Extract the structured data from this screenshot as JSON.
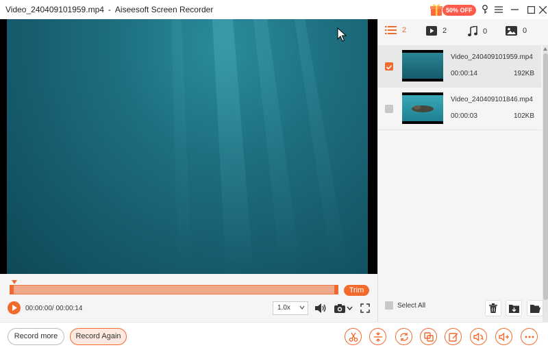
{
  "window": {
    "file_name": "Video_240409101959.mp4",
    "separator": "-",
    "app_name": "Aiseesoft Screen Recorder",
    "promo_label": "50% OFF"
  },
  "player": {
    "time": "00:00:00/ 00:00:14",
    "trim_label": "Trim",
    "speed": "1.0x",
    "progress": 0.0
  },
  "media_tabs": [
    {
      "icon": "list-icon",
      "count": "2",
      "active": true
    },
    {
      "icon": "video-play-icon",
      "count": "2",
      "active": false
    },
    {
      "icon": "music-note-icon",
      "count": "0",
      "active": false
    },
    {
      "icon": "image-icon",
      "count": "0",
      "active": false
    }
  ],
  "files": [
    {
      "name": "Video_240409101959.mp4",
      "duration": "00:00:14",
      "size": "192KB",
      "checked": true
    },
    {
      "name": "Video_240409101846.mp4",
      "duration": "00:00:03",
      "size": "102KB",
      "checked": false
    }
  ],
  "panel": {
    "select_all_label": "Select All"
  },
  "bottom": {
    "record_more_label": "Record more",
    "record_again_label": "Record Again",
    "tools": [
      "scissors-icon",
      "merge-icon",
      "rotate-icon",
      "copy-icon",
      "edit-icon",
      "audio-convert-icon",
      "volume-boost-icon",
      "more-icon"
    ]
  },
  "colors": {
    "accent": "#f26a2c",
    "video_teal": "#1d6f80"
  }
}
